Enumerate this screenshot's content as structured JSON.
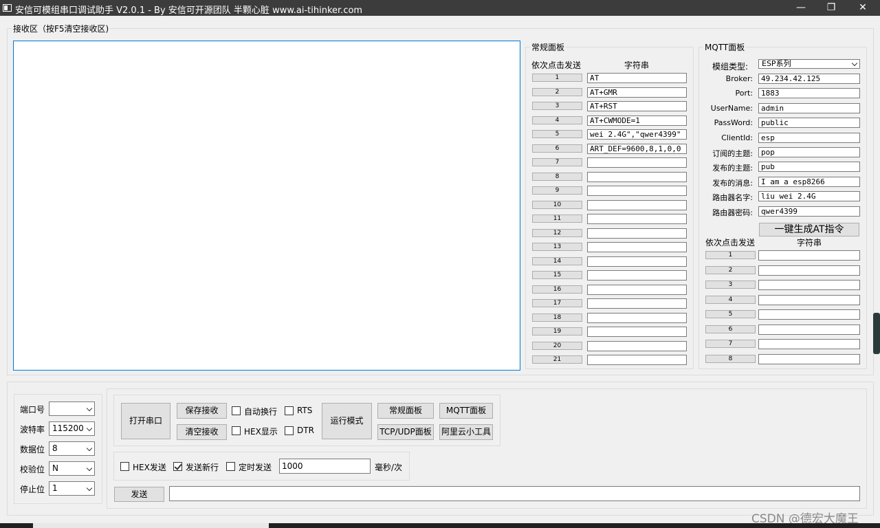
{
  "window": {
    "title": "安信可模组串口调试助手 V2.0.1 - By 安信可开源团队 半颗心脏 www.ai-tihinker.com",
    "minimize": "—",
    "restore": "❐",
    "close": "✕"
  },
  "receive": {
    "title": "接收区（按F5清空接收区)"
  },
  "normal_panel": {
    "title": "常规面板",
    "col_send": "依次点击发送",
    "col_string": "字符串",
    "rows": [
      {
        "n": "1",
        "v": "AT"
      },
      {
        "n": "2",
        "v": "AT+GMR"
      },
      {
        "n": "3",
        "v": "AT+RST"
      },
      {
        "n": "4",
        "v": "AT+CWMODE=1"
      },
      {
        "n": "5",
        "v": "wei 2.4G\",\"qwer4399\""
      },
      {
        "n": "6",
        "v": "ART_DEF=9600,8,1,0,0"
      },
      {
        "n": "7",
        "v": ""
      },
      {
        "n": "8",
        "v": ""
      },
      {
        "n": "9",
        "v": ""
      },
      {
        "n": "10",
        "v": ""
      },
      {
        "n": "11",
        "v": ""
      },
      {
        "n": "12",
        "v": ""
      },
      {
        "n": "13",
        "v": ""
      },
      {
        "n": "14",
        "v": ""
      },
      {
        "n": "15",
        "v": ""
      },
      {
        "n": "16",
        "v": ""
      },
      {
        "n": "17",
        "v": ""
      },
      {
        "n": "18",
        "v": ""
      },
      {
        "n": "19",
        "v": ""
      },
      {
        "n": "20",
        "v": ""
      },
      {
        "n": "21",
        "v": ""
      }
    ]
  },
  "mqtt_panel": {
    "title": "MQTT面板",
    "module_type_label": "模组类型:",
    "module_type_value": "ESP系列",
    "fields": [
      {
        "label": "Broker:",
        "value": "49.234.42.125"
      },
      {
        "label": "Port:",
        "value": "1883"
      },
      {
        "label": "UserName:",
        "value": "admin"
      },
      {
        "label": "PassWord:",
        "value": "public"
      },
      {
        "label": "ClientId:",
        "value": "esp"
      },
      {
        "label": "订阅的主题:",
        "value": "pop"
      },
      {
        "label": "发布的主题:",
        "value": "pub"
      },
      {
        "label": "发布的消息:",
        "value": "I am a esp8266"
      },
      {
        "label": "路由器名字:",
        "value": "liu wei 2.4G"
      },
      {
        "label": "路由器密码:",
        "value": "qwer4399"
      }
    ],
    "gen_button": "一键生成AT指令",
    "col_send": "依次点击发送",
    "col_string": "字符串",
    "rows": [
      {
        "n": "1",
        "v": ""
      },
      {
        "n": "2",
        "v": ""
      },
      {
        "n": "3",
        "v": ""
      },
      {
        "n": "4",
        "v": ""
      },
      {
        "n": "5",
        "v": ""
      },
      {
        "n": "6",
        "v": ""
      },
      {
        "n": "7",
        "v": ""
      },
      {
        "n": "8",
        "v": ""
      }
    ]
  },
  "serial": {
    "port_label": "端口号",
    "port_value": "",
    "baud_label": "波特率",
    "baud_value": "115200",
    "data_label": "数据位",
    "data_value": "8",
    "parity_label": "校验位",
    "parity_value": "N",
    "stop_label": "停止位",
    "stop_value": "1"
  },
  "controls": {
    "open_port": "打开串口",
    "save_recv": "保存接收",
    "clear_recv": "清空接收",
    "auto_wrap": "自动换行",
    "hex_display": "HEX显示",
    "rts": "RTS",
    "dtr": "DTR",
    "run_mode": "运行模式",
    "normal_panel_btn": "常规面板",
    "mqtt_panel_btn": "MQTT面板",
    "tcp_udp_btn": "TCP/UDP面板",
    "aliyun_btn": "阿里云小工具"
  },
  "send_opts": {
    "hex_send": "HEX发送",
    "send_newline": "发送新行",
    "timed_send": "定时发送",
    "interval": "1000",
    "interval_unit": "毫秒/次",
    "send_btn": "发送",
    "send_text": ""
  },
  "watermark": "CSDN @德宏大魔王"
}
